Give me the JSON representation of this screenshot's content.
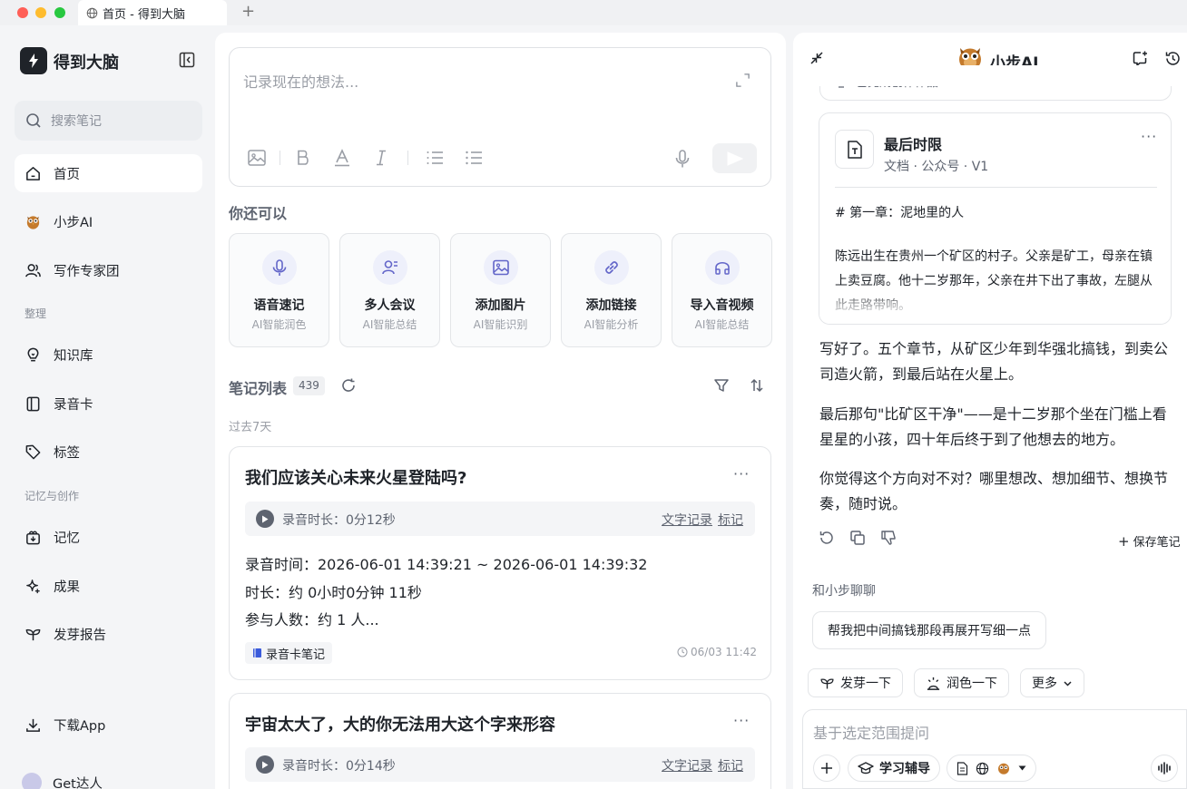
{
  "window": {
    "tab_title": "首页 - 得到大脑"
  },
  "sidebar": {
    "brand": "得到大脑",
    "search_placeholder": "搜索笔记",
    "items": [
      {
        "label": "首页",
        "icon": "home-icon"
      },
      {
        "label": "小步AI",
        "icon": "owl-icon"
      },
      {
        "label": "写作专家团",
        "icon": "people-icon"
      },
      {
        "label": "知识库",
        "icon": "lightbulb-icon"
      },
      {
        "label": "录音卡",
        "icon": "card-icon"
      },
      {
        "label": "标签",
        "icon": "tag-icon"
      },
      {
        "label": "记忆",
        "icon": "memory-icon"
      },
      {
        "label": "成果",
        "icon": "sparkle-icon"
      },
      {
        "label": "发芽报告",
        "icon": "sprout-icon"
      }
    ],
    "section_organize": "整理",
    "section_memory": "记忆与创作",
    "download": "下载App",
    "user": "Get达人"
  },
  "editor": {
    "placeholder": "记录现在的想法..."
  },
  "also": {
    "title": "你还可以",
    "actions": [
      {
        "title": "语音速记",
        "sub": "AI智能润色"
      },
      {
        "title": "多人会议",
        "sub": "AI智能总结"
      },
      {
        "title": "添加图片",
        "sub": "AI智能识别"
      },
      {
        "title": "添加链接",
        "sub": "AI智能分析"
      },
      {
        "title": "导入音视频",
        "sub": "AI智能总结"
      }
    ]
  },
  "notes": {
    "title": "笔记列表",
    "count": "439",
    "period": "过去7天",
    "items": [
      {
        "title": "我们应该关心未来火星登陆吗?",
        "duration": "录音时长：0分12秒",
        "link_text": "文字记录",
        "link_mark": "标记",
        "lines": [
          "录音时间：2026-06-01 14:39:21 ~ 2026-06-01 14:39:32",
          "时长：约 0小时0分钟 11秒",
          "参与人数：约 1 人..."
        ],
        "tag": "录音卡笔记",
        "date": "06/03 11:42"
      },
      {
        "title": "宇宙太大了，大的你无法用大这个字来形容",
        "duration": "录音时长：0分14秒",
        "link_text": "文字记录",
        "link_mark": "标记"
      }
    ]
  },
  "assistant": {
    "title": "小步AI",
    "clipped_top": "已完成创作作品",
    "doc": {
      "title": "最后时限",
      "meta": "文档 · 公众号 · V1",
      "heading": "# 第一章：泥地里的人",
      "body": "陈远出生在贵州一个矿区的村子。父亲是矿工，母亲在镇上卖豆腐。他十二岁那年，父亲在井下出了事故，左腿从此走路带响。"
    },
    "messages": [
      "写好了。五个章节，从矿区少年到华强北搞钱，到卖公司造火箭，到最后站在火星上。",
      "最后那句\"比矿区干净\"——是十二岁那个坐在门槛上看星星的小孩，四十年后终于到了他想去的地方。",
      "你觉得这个方向对不对？哪里想改、想加细节、想换节奏，随时说。"
    ],
    "save_note": "保存笔记",
    "chat_title": "和小步聊聊",
    "suggestion": "帮我把中间搞钱那段再展开写细一点",
    "chips": [
      "发芽一下",
      "润色一下",
      "更多"
    ],
    "input_placeholder": "基于选定范围提问",
    "study_mode": "学习辅导"
  }
}
